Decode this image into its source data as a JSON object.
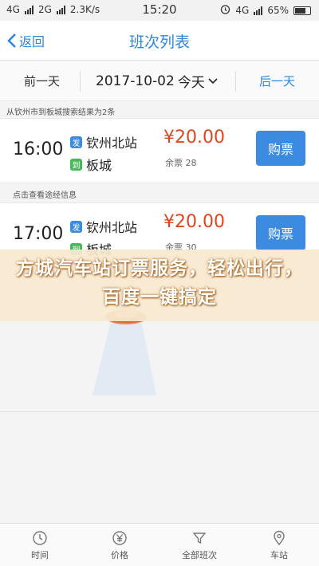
{
  "status_bar": {
    "net1": "4G",
    "net2": "2G",
    "speed": "2.3K/s",
    "time": "15:20",
    "net3": "4G",
    "battery": "65%"
  },
  "nav": {
    "back_label": "返回",
    "title": "班次列表"
  },
  "date_bar": {
    "prev_label": "前一天",
    "date": "2017-10-02",
    "day_label": "今天",
    "next_label": "后一天"
  },
  "summary": "从钦州市到板城搜索结果为2条",
  "tickets": [
    {
      "time": "16:00",
      "from_tag": "发",
      "from": "钦州北站",
      "to_tag": "到",
      "to": "板城",
      "price": "¥20.00",
      "seats": "余票 28",
      "buy_label": "购票"
    },
    {
      "time": "17:00",
      "from_tag": "发",
      "from": "钦州北站",
      "to_tag": "到",
      "to": "板城",
      "price": "¥20.00",
      "seats": "余票 30",
      "buy_label": "购票"
    }
  ],
  "hint1": "点击查看途经信息",
  "banner_text": "方城汽车站订票服务，轻松出行，百度一键搞定",
  "tabs": [
    {
      "label": "时间",
      "icon": "clock-icon"
    },
    {
      "label": "价格",
      "icon": "yen-icon"
    },
    {
      "label": "全部班次",
      "icon": "filter-icon"
    },
    {
      "label": "车站",
      "icon": "location-icon"
    }
  ],
  "colors": {
    "accent": "#2e86de",
    "price": "#e0461d",
    "button": "#3b8be0"
  }
}
